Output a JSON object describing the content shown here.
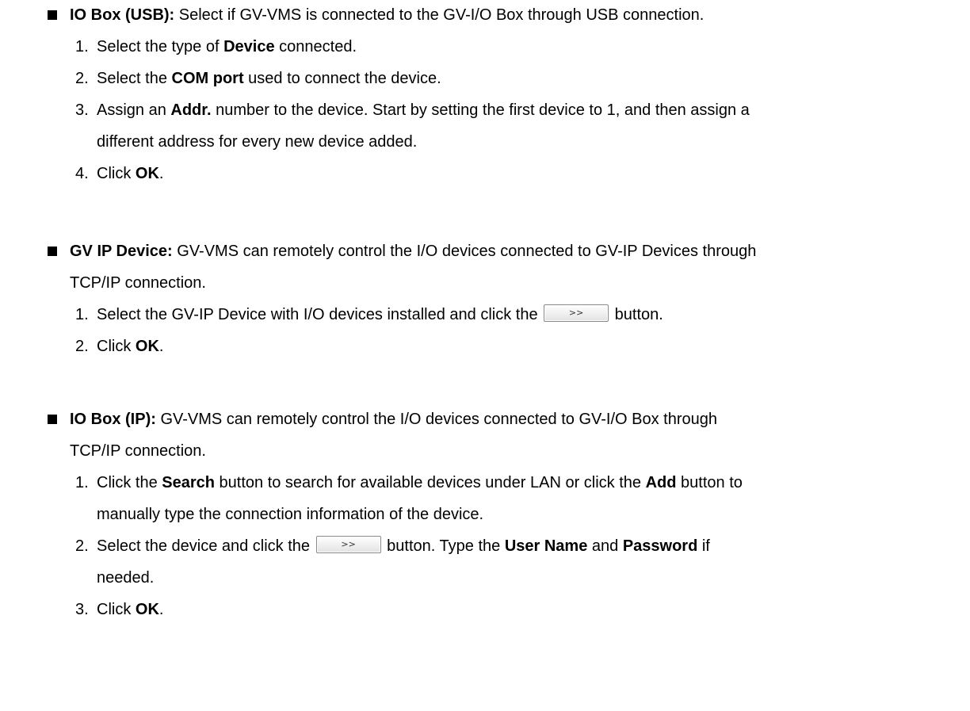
{
  "sections": [
    {
      "title": "IO Box (USB):",
      "intro": " Select if GV-VMS is connected to the GV-I/O Box through USB connection.",
      "steps": [
        {
          "num": "1.",
          "a": "Select the type of ",
          "b": "Device",
          "c": " connected."
        },
        {
          "num": "2.",
          "a": "Select the ",
          "b": "COM port",
          "c": " used to connect the device."
        },
        {
          "num": "3.",
          "a": "Assign an ",
          "b": "Addr.",
          "c": " number to the device. Start by setting the first device to 1, and then assign a",
          "cont": "different address for every new device added."
        },
        {
          "num": "4.",
          "a": "Click ",
          "b": "OK",
          "c": "."
        }
      ]
    },
    {
      "title": "GV IP Device:",
      "intro": " GV-VMS can remotely control the I/O devices connected to GV-IP Devices through",
      "intro_cont": "TCP/IP connection.",
      "steps": [
        {
          "num": "1.",
          "a": "Select the GV-IP Device with I/O devices installed and click the ",
          "btn": ">>",
          "c": " button."
        },
        {
          "num": "2.",
          "a": "Click ",
          "b": "OK",
          "c": "."
        }
      ]
    },
    {
      "title": "IO Box (IP):",
      "intro": " GV-VMS can remotely control the I/O devices connected to GV-I/O Box through",
      "intro_cont": "TCP/IP connection.",
      "steps": [
        {
          "num": "1.",
          "a": "Click the ",
          "b": "Search",
          "c": " button to search for available devices under LAN or click the ",
          "d": "Add",
          "e": " button to",
          "cont": "manually type the connection information of the device."
        },
        {
          "num": "2.",
          "a": "Select the device and click the ",
          "btn": ">>",
          "c": " button. Type the ",
          "d": "User Name",
          "e": " and ",
          "f": "Password",
          "g": " if",
          "cont": "needed."
        },
        {
          "num": "3.",
          "a": "Click ",
          "b": "OK",
          "c": "."
        }
      ]
    }
  ]
}
